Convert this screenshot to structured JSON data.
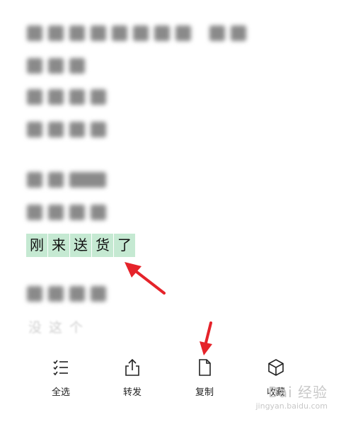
{
  "message": {
    "selected_text": [
      "刚",
      "来",
      "送",
      "货",
      "了"
    ],
    "partial_text": "没这个"
  },
  "toolbar": {
    "select_all": "全选",
    "forward": "转发",
    "copy": "复制",
    "favorite": "收藏"
  },
  "watermark": {
    "brand": "Bai 经验",
    "url": "jingyan.baidu.com"
  },
  "colors": {
    "selection": "#c5e9d2",
    "handle": "#1fb36a",
    "arrow": "#e5232a"
  }
}
